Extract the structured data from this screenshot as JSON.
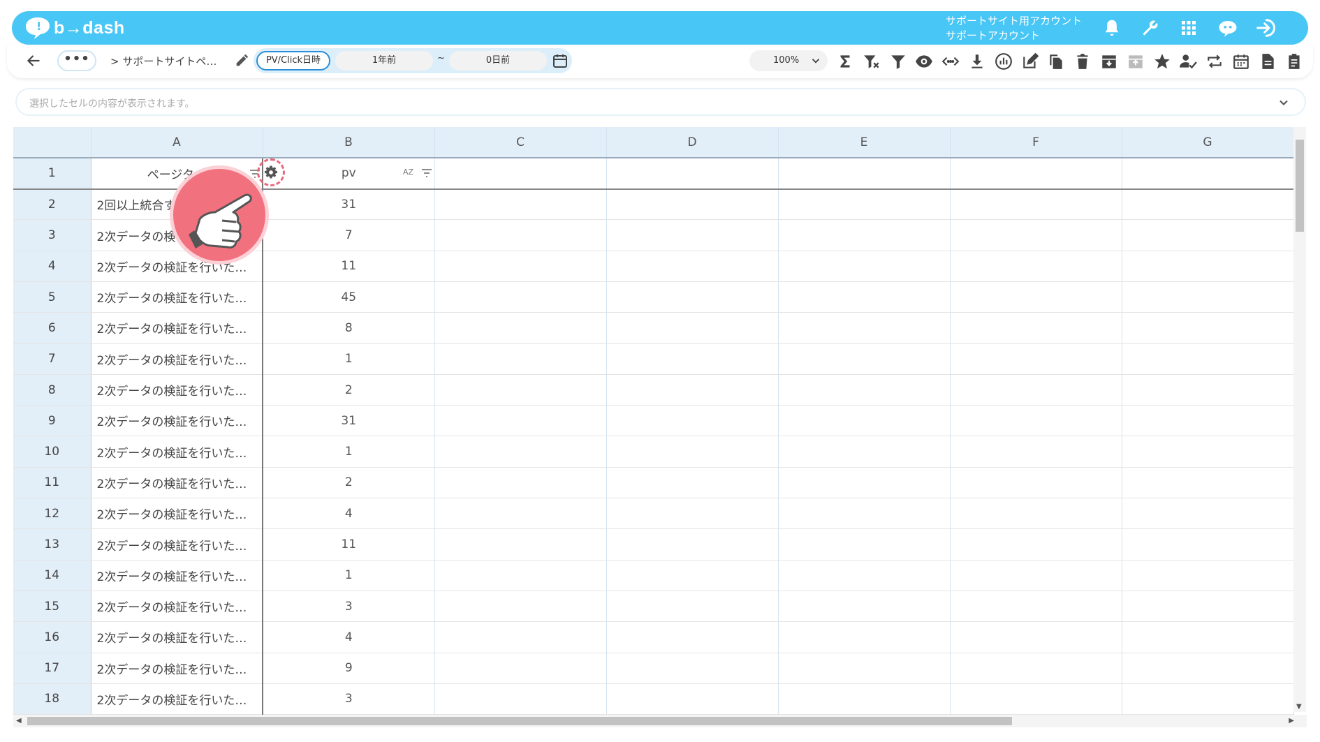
{
  "app": {
    "logo_text": "b→dash",
    "account_line1": "サポートサイト用アカウント",
    "account_line2": "サポートアカウント"
  },
  "header_icons": [
    "bell-icon",
    "wrench-icon",
    "apps-grid-icon",
    "chat-bot-icon",
    "logout-icon"
  ],
  "toolbar": {
    "more_label": "•••",
    "breadcrumb": "> サポートサイトペ…",
    "date_mode": "PV/Click日時",
    "date_from": "1年前",
    "date_separator": "~",
    "date_to": "0日前",
    "zoom": "100%",
    "icons": [
      "sum-icon",
      "filter-clear-icon",
      "filter-icon",
      "eye-icon",
      "code-icon",
      "download-icon",
      "chart-icon",
      "edit-icon",
      "copy-icon",
      "trash-icon",
      "archive-icon",
      "archive-disabled-icon",
      "star-icon",
      "user-check-icon",
      "repeat-icon",
      "calendar-icon",
      "document-icon",
      "clipboard-icon"
    ]
  },
  "formula_bar": {
    "placeholder": "選択したセルの内容が表示されます。"
  },
  "grid": {
    "columns": [
      "A",
      "B",
      "C",
      "D",
      "E",
      "F",
      "G"
    ],
    "header_row": {
      "row": "1",
      "a": "ページタイ",
      "b": "pv",
      "sort_label": "AZ"
    },
    "rows": [
      {
        "row": "2",
        "a": "2回以上統合す",
        "b": "31"
      },
      {
        "row": "3",
        "a": "2次データの検",
        "b": "7"
      },
      {
        "row": "4",
        "a": "2次データの検証を行いた…",
        "b": "11"
      },
      {
        "row": "5",
        "a": "2次データの検証を行いた…",
        "b": "45"
      },
      {
        "row": "6",
        "a": "2次データの検証を行いた…",
        "b": "8"
      },
      {
        "row": "7",
        "a": "2次データの検証を行いた…",
        "b": "1"
      },
      {
        "row": "8",
        "a": "2次データの検証を行いた…",
        "b": "2"
      },
      {
        "row": "9",
        "a": "2次データの検証を行いた…",
        "b": "31"
      },
      {
        "row": "10",
        "a": "2次データの検証を行いた…",
        "b": "1"
      },
      {
        "row": "11",
        "a": "2次データの検証を行いた…",
        "b": "2"
      },
      {
        "row": "12",
        "a": "2次データの検証を行いた…",
        "b": "4"
      },
      {
        "row": "13",
        "a": "2次データの検証を行いた…",
        "b": "11"
      },
      {
        "row": "14",
        "a": "2次データの検証を行いた…",
        "b": "1"
      },
      {
        "row": "15",
        "a": "2次データの検証を行いた…",
        "b": "3"
      },
      {
        "row": "16",
        "a": "2次データの検証を行いた…",
        "b": "4"
      },
      {
        "row": "17",
        "a": "2次データの検証を行いた…",
        "b": "9"
      },
      {
        "row": "18",
        "a": "2次データの検証を行いた…",
        "b": "3"
      }
    ]
  },
  "colors": {
    "header_bg": "#48c6f5",
    "accent_blue": "#2a8fd8",
    "highlight_pink": "#e9677b",
    "grid_header_bg": "#e2eef8"
  }
}
